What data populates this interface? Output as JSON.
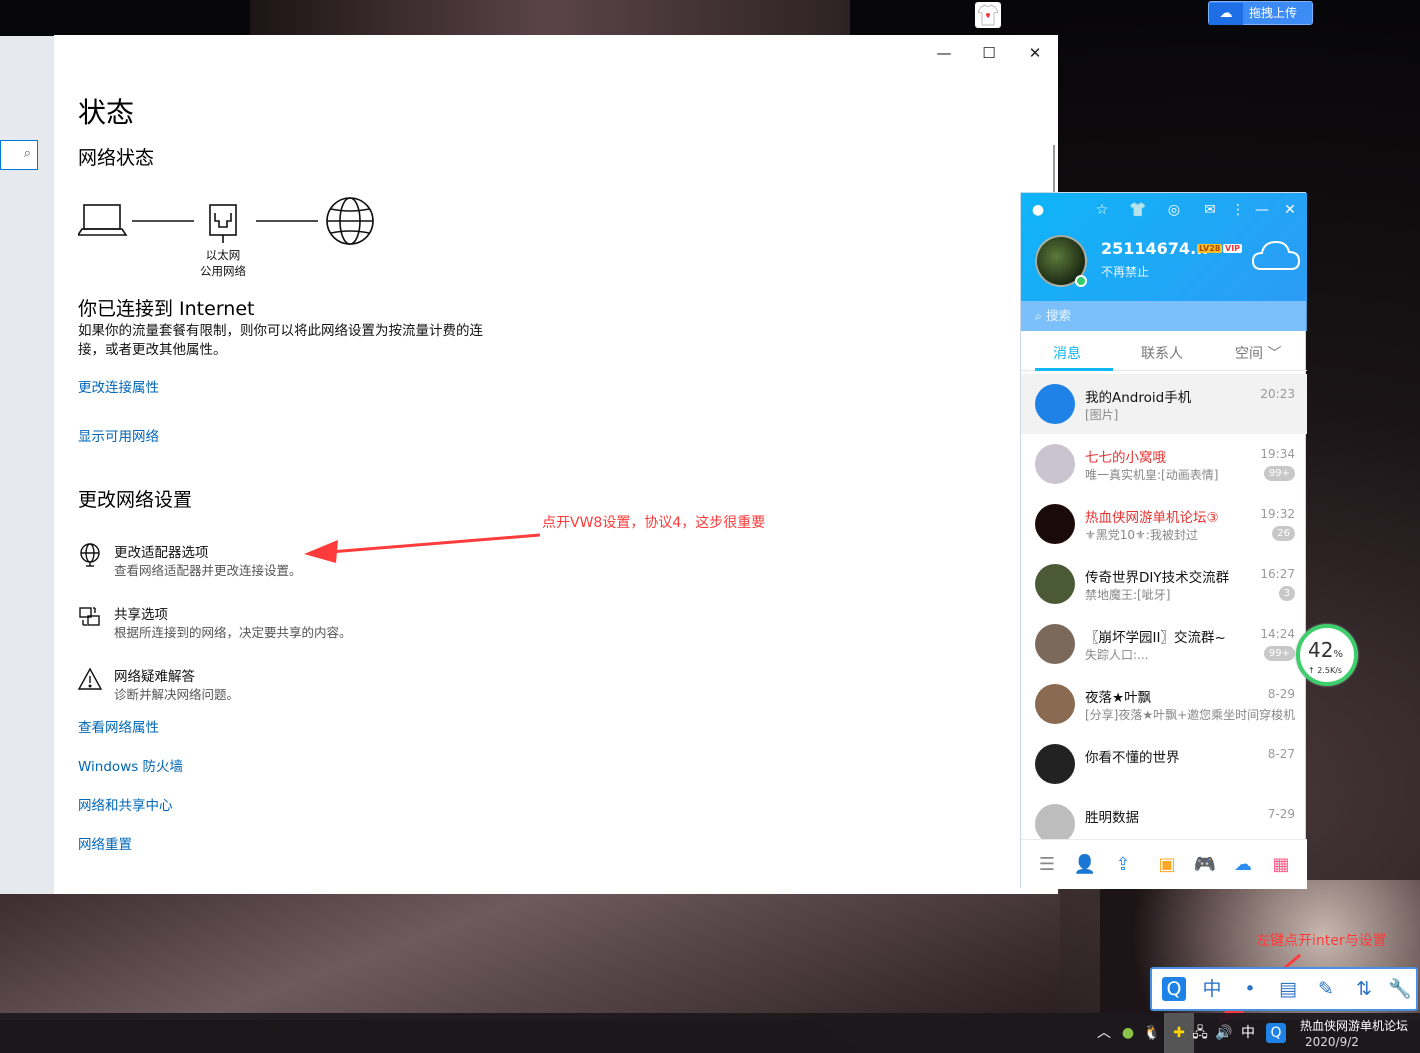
{
  "desktop": {
    "upload_button_label": "拖拽上传"
  },
  "settings": {
    "window_controls": {
      "minimize": "—",
      "maximize": "☐",
      "close": "✕"
    },
    "page_title": "状态",
    "network_status_heading": "网络状态",
    "diagram_label_1": "以太网",
    "diagram_label_2": "公用网络",
    "connected_heading": "你已连接到 Internet",
    "connected_description": "如果你的流量套餐有限制，则你可以将此网络设置为按流量计费的连接，或者更改其他属性。",
    "link_change_connection_properties": "更改连接属性",
    "link_show_available_networks": "显示可用网络",
    "change_settings_heading": "更改网络设置",
    "options": [
      {
        "title": "更改适配器选项",
        "description": "查看网络适配器并更改连接设置。",
        "icon": "adapter-icon"
      },
      {
        "title": "共享选项",
        "description": "根据所连接到的网络，决定要共享的内容。",
        "icon": "sharing-icon"
      },
      {
        "title": "网络疑难解答",
        "description": "诊断并解决网络问题。",
        "icon": "warning-icon"
      }
    ],
    "link_view_network_properties": "查看网络属性",
    "link_windows_firewall": "Windows 防火墙",
    "link_network_sharing_center": "网络和共享中心",
    "link_network_reset": "网络重置"
  },
  "annotations": {
    "arrow_1_text": "点开VW8设置，协议4，这步很重要",
    "arrow_2_text": "左键点开inter与设置"
  },
  "qq": {
    "account_name": "25114674...",
    "level_badge": "LV28",
    "vip_badge": "VIP",
    "signature": "不再禁止",
    "search_placeholder": "搜索",
    "tabs": [
      "消息",
      "联系人",
      "空间 ﹀"
    ],
    "conversations": [
      {
        "name": "我的Android手机",
        "preview": "[图片]",
        "time": "20:23",
        "badge": "",
        "name_red": false,
        "avatar_color": "#1e82e6"
      },
      {
        "name": "七七的小窝哦",
        "preview": "唯一真实机皇:[动画表情]",
        "time": "19:34",
        "badge": "99+",
        "name_red": true,
        "avatar_color": "#c9c4cf"
      },
      {
        "name": "热血侠网游单机论坛③",
        "preview": "⚜黑党10⚜:我被封过",
        "time": "19:32",
        "badge": "26",
        "name_red": true,
        "avatar_color": "#1a0a0a"
      },
      {
        "name": "传奇世界DIY技术交流群",
        "preview": "禁地魔王:[呲牙]",
        "time": "16:27",
        "badge": "3",
        "name_red": false,
        "avatar_color": "#4b5a36"
      },
      {
        "name": "〖崩坏学园II〗交流群~",
        "preview": "失踪人口:...",
        "time": "14:24",
        "badge": "99+",
        "name_red": false,
        "avatar_color": "#7b6a5c"
      },
      {
        "name": "夜落★叶飘",
        "preview": "[分享]夜落★叶飘+邀您乘坐时间穿梭机",
        "time": "8-29",
        "badge": "",
        "name_red": false,
        "avatar_color": "#8a6a50"
      },
      {
        "name": "你看不懂的世界",
        "preview": "",
        "time": "8-27",
        "badge": "",
        "name_red": false,
        "avatar_color": "#222"
      },
      {
        "name": "胜明数据",
        "preview": "",
        "time": "7-29",
        "badge": "",
        "name_red": false,
        "avatar_color": "#bdbdbd"
      }
    ]
  },
  "speed_widget": {
    "percent": "42",
    "percent_unit": "%",
    "speed": "↑ 2.5K/s"
  },
  "ime_bar": {
    "lang_char": "中"
  },
  "taskbar": {
    "ime_indicator": "中",
    "tray_text": "热血侠网游单机论坛",
    "date": "2020/9/2"
  }
}
